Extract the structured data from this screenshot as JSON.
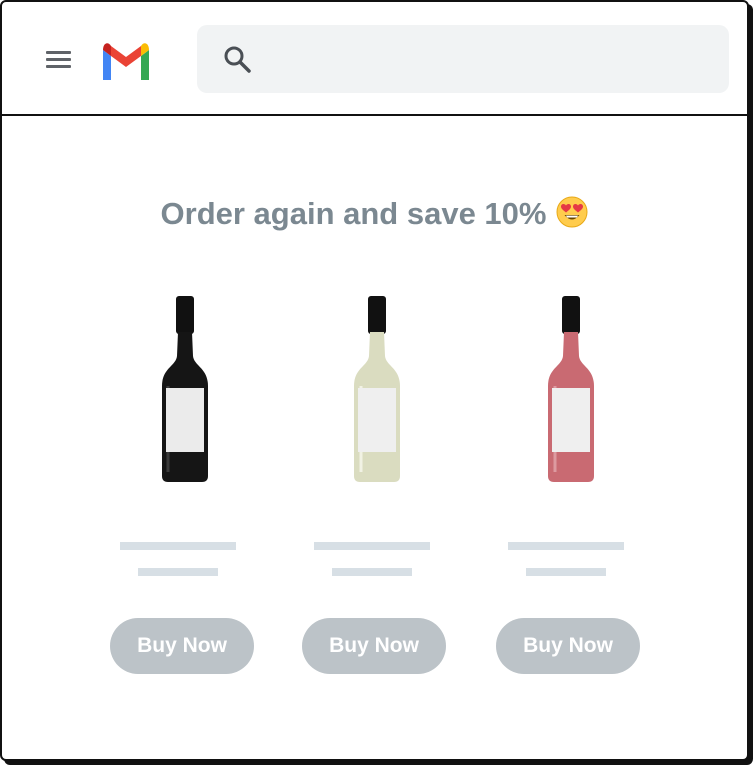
{
  "header": {
    "menu_icon": "menu-icon",
    "logo_icon": "gmail-logo-icon",
    "search": {
      "icon": "search-icon",
      "value": "",
      "placeholder": ""
    }
  },
  "promo": {
    "headline": "Order again and save 10%",
    "emoji": "heart-eyes-emoji"
  },
  "products": [
    {
      "bottle": "dark-red-wine-bottle",
      "button_label": "Buy Now",
      "bottle_color": "#151515"
    },
    {
      "bottle": "white-wine-bottle",
      "button_label": "Buy Now",
      "bottle_color": "#d9dcbf"
    },
    {
      "bottle": "rose-wine-bottle",
      "button_label": "Buy Now",
      "bottle_color": "#c96a72"
    }
  ],
  "colors": {
    "headline": "#7b8891",
    "button_bg": "#bcc3c8",
    "placeholder_lines": "#d7dfe5",
    "search_bg": "#f1f3f4"
  }
}
